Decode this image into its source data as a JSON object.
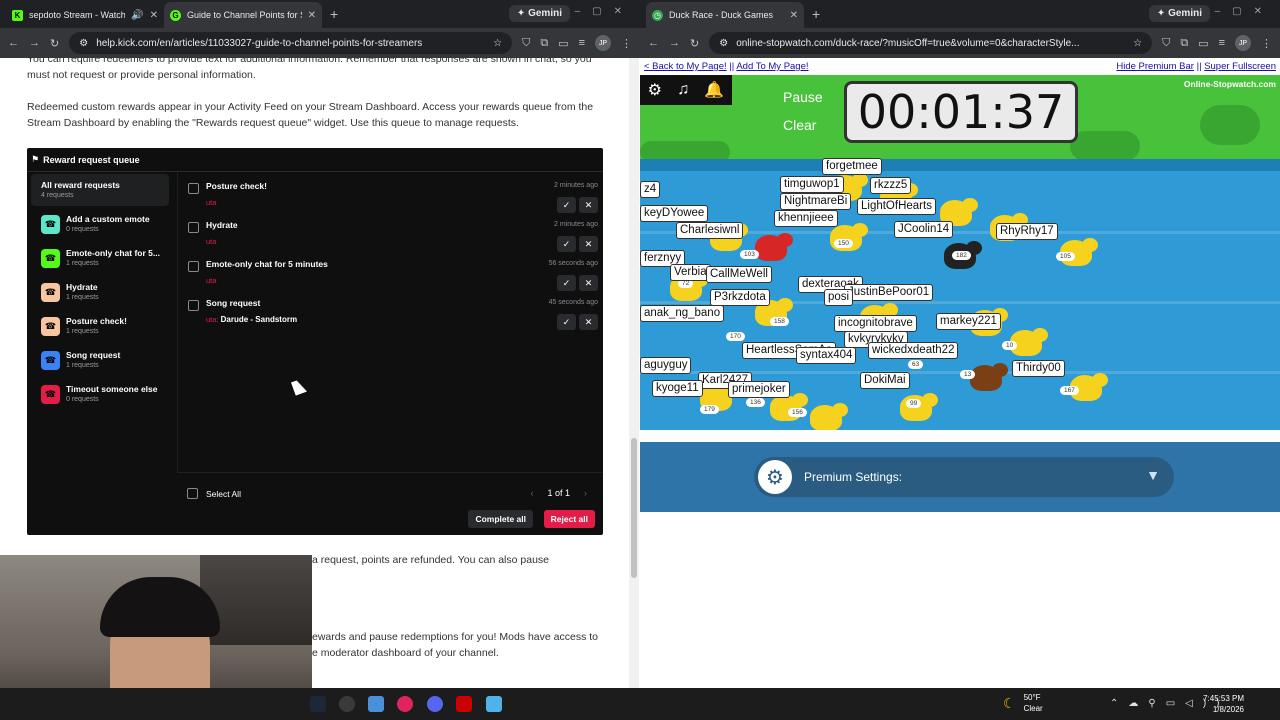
{
  "left_window": {
    "tabs": [
      {
        "title": "sepdoto Stream - Watch Li",
        "favicon": "K",
        "favicon_color": "#53fc18",
        "active": false
      },
      {
        "title": "Guide to Channel Points for Str",
        "favicon": "G",
        "favicon_color": "#53fc18",
        "active": true
      }
    ],
    "gemini_label": "Gemini",
    "url": "help.kick.com/en/articles/11033027-guide-to-channel-points-for-streamers",
    "profile": "JP"
  },
  "article": {
    "para1": "You can require redeemers to provide text for additional information. Remember that responses are shown in chat, so you must not request or provide personal information.",
    "para2": "Redeemed custom rewards appear in your Activity Feed on your Stream Dashboard. Access your rewards queue from the Stream Dashboard by enabling the \"Rewards request queue\" widget. Use this queue to manage requests.",
    "para3": "a request, points are refunded. You can also pause",
    "para4": "ewards and pause redemptions for you! Mods have access to",
    "para5": "e moderator dashboard of your channel."
  },
  "reward_queue": {
    "title": "Reward request queue",
    "sidebar": [
      {
        "label": "All reward requests",
        "count": "4 requests",
        "color": "",
        "selected": true
      },
      {
        "label": "Add a custom emote",
        "count": "0 requests",
        "color": "#5ee6c8"
      },
      {
        "label": "Emote-only chat for 5...",
        "count": "1 requests",
        "color": "#53fc18"
      },
      {
        "label": "Hydrate",
        "count": "1 requests",
        "color": "#f7c59f"
      },
      {
        "label": "Posture check!",
        "count": "1 requests",
        "color": "#f7c59f"
      },
      {
        "label": "Song request",
        "count": "1 requests",
        "color": "#3b82f6"
      },
      {
        "label": "Timeout someone else",
        "count": "0 requests",
        "color": "#e11d48"
      }
    ],
    "requests": [
      {
        "name": "Posture check!",
        "time": "2 minutes ago",
        "user": "uta",
        "input": ""
      },
      {
        "name": "Hydrate",
        "time": "2 minutes ago",
        "user": "uta",
        "input": ""
      },
      {
        "name": "Emote-only chat for 5 minutes",
        "time": "56 seconds ago",
        "user": "uta",
        "input": ""
      },
      {
        "name": "Song request",
        "time": "45 seconds ago",
        "user": "uta",
        "input": "Darude - Sandstorm"
      }
    ],
    "select_all": "Select All",
    "page": "1 of 1",
    "complete_all": "Complete all",
    "reject_all": "Reject all"
  },
  "right_window": {
    "tabs": [
      {
        "title": "Duck Race - Duck Games",
        "favicon": "◷",
        "favicon_color": "#35a853",
        "active": true
      }
    ],
    "gemini_label": "Gemini",
    "url": "online-stopwatch.com/duck-race/?musicOff=true&volume=0&characterStyle...",
    "profile": "JP"
  },
  "duck_page": {
    "back_link": "< Back to My Page!",
    "sep": "||",
    "add_link": "Add To My Page!",
    "hide_link": "Hide Premium Bar",
    "sep2": "||",
    "fullscreen_link": "Super Fullscreen",
    "pause": "Pause",
    "clear": "Clear",
    "timer": "00:01:37",
    "brand": "Online-Stopwatch.com",
    "premium_settings": "Premium Settings:",
    "duck_names": [
      "forgetmee",
      "timguwop1",
      "rkzzz5",
      "NightmareBi",
      "LightOfHearts",
      "keyDYowee",
      "khennjieee",
      "Charlesiwnl",
      "JCoolin14",
      "RhyRhy17",
      "ferznyy",
      "Verbia",
      "CallMeWell",
      "dexteraoak",
      "JustinBePoor01",
      "P3rkzdota",
      "posi",
      "anak_ng_bano",
      "markey221",
      "incognitobrave",
      "kvkyrykvkv",
      "HeartlessSamAa",
      "syntax404",
      "wickedxdeath22",
      "aguyguy",
      "Thirdy00",
      "Karl2427",
      "kyoge11",
      "primejoker",
      "DokiMai",
      "z4"
    ],
    "duck_numbers": [
      "103",
      "150",
      "182",
      "105",
      "72",
      "158",
      "170",
      "63",
      "10",
      "13",
      "167",
      "179",
      "136",
      "156",
      "99"
    ]
  },
  "taskbar": {
    "temp": "50°F",
    "condition": "Clear",
    "time": "7:45:53 PM",
    "date": "1/8/2026"
  }
}
